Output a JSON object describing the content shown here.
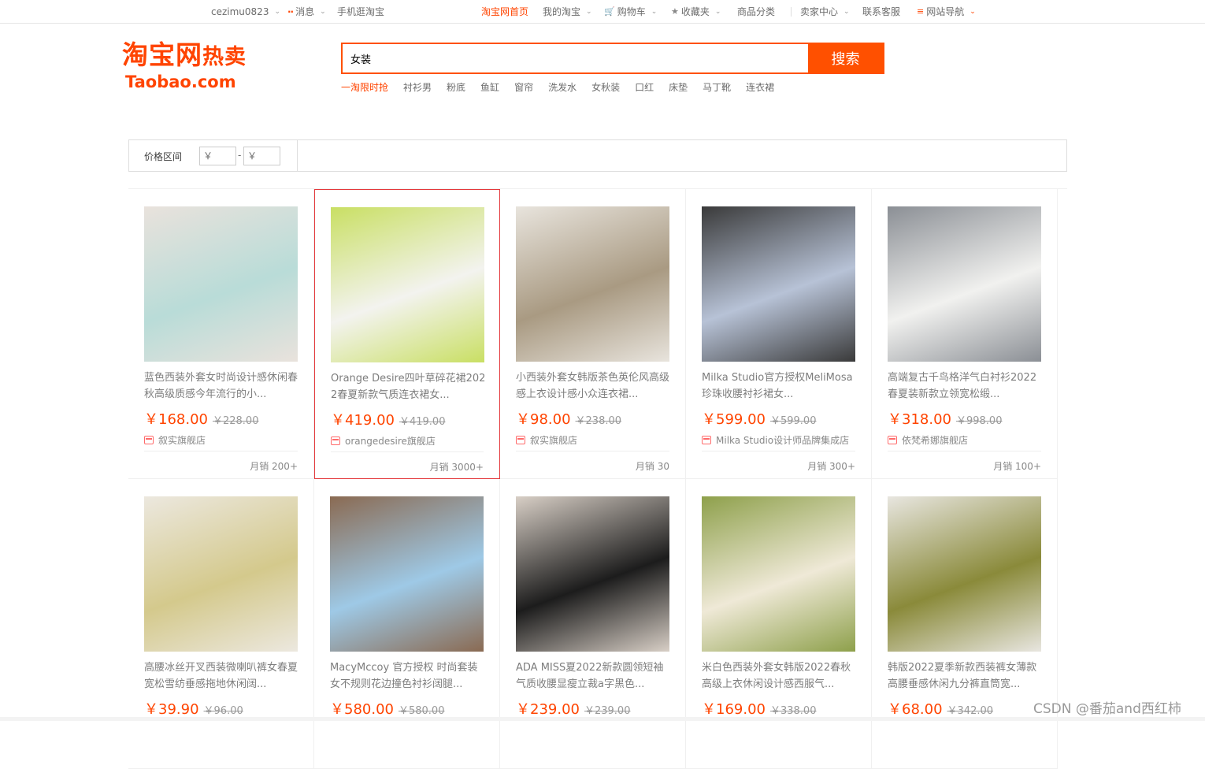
{
  "topbar": {
    "username": "cezimu0823",
    "messages": "消息",
    "mobile": "手机逛淘宝",
    "home": "淘宝网首页",
    "my_taobao": "我的淘宝",
    "cart": "购物车",
    "favorites": "收藏夹",
    "categories": "商品分类",
    "seller_center": "卖家中心",
    "contact": "联系客服",
    "site_nav": "网站导航",
    "accent": "#ff4400"
  },
  "logo": {
    "cn": "淘宝网",
    "cn_small": "热卖",
    "en": "Taobao.com"
  },
  "search": {
    "value": "女装",
    "button": "搜索"
  },
  "hotwords": [
    "一淘限时抢",
    "衬衫男",
    "粉底",
    "鱼缸",
    "窗帘",
    "洗发水",
    "女秋装",
    "口红",
    "床垫",
    "马丁靴",
    "连衣裙"
  ],
  "filter": {
    "label": "价格区间",
    "min_placeholder": "￥",
    "max_placeholder": "￥",
    "dash": "-"
  },
  "products": [
    {
      "title": "蓝色西装外套女时尚设计感休闲春秋高级质感今年流行的小...",
      "price": "￥168.00",
      "old": "￥228.00",
      "shop": "叙实旗舰店",
      "sales": "月销 200+",
      "colors": [
        "#b9dcd8",
        "#e9e2dc"
      ]
    },
    {
      "title": "Orange Desire四叶草碎花裙2022春夏新款气质连衣裙女...",
      "price": "￥419.00",
      "old": "￥419.00",
      "shop": "orangedesire旗舰店",
      "sales": "月销 3000+",
      "colors": [
        "#f3f3ef",
        "#c9df63"
      ]
    },
    {
      "title": "小西装外套女韩版茶色英伦风高级感上衣设计感小众连衣裙...",
      "price": "￥98.00",
      "old": "￥238.00",
      "shop": "叙实旗舰店",
      "sales": "月销 30",
      "colors": [
        "#a99a82",
        "#e8e4dd"
      ]
    },
    {
      "title": "Milka Studio官方授权MeliMosa珍珠收腰衬衫裙女...",
      "price": "￥599.00",
      "old": "￥599.00",
      "shop": "Milka Studio设计师品牌集成店",
      "sales": "月销 300+",
      "colors": [
        "#b7c2d6",
        "#3a3a3a"
      ]
    },
    {
      "title": "高端复古千鸟格洋气白衬衫2022春夏装新款立领宽松缎...",
      "price": "￥318.00",
      "old": "￥998.00",
      "shop": "依梵希娜旗舰店",
      "sales": "月销 100+",
      "colors": [
        "#f1f1ef",
        "#8b8f95"
      ]
    },
    {
      "title": "高腰冰丝开叉西装微喇叭裤女春夏宽松雪纺垂感拖地休闲阔...",
      "price": "￥39.90",
      "old": "￥96.00",
      "shop": "",
      "sales": "",
      "colors": [
        "#d4c98c",
        "#ece8df"
      ]
    },
    {
      "title": "MacyMccoy 官方授权 时尚套装女不规则花边撞色衬衫阔腿...",
      "price": "￥580.00",
      "old": "￥580.00",
      "shop": "",
      "sales": "",
      "colors": [
        "#9ec9e6",
        "#8a6a52"
      ]
    },
    {
      "title": "ADA MISS夏2022新款圆领短袖气质收腰显瘦立裁a字黑色...",
      "price": "￥239.00",
      "old": "￥239.00",
      "shop": "",
      "sales": "",
      "colors": [
        "#1c1c1c",
        "#d8cfc6"
      ]
    },
    {
      "title": "米白色西装外套女韩版2022春秋高级上衣休闲设计感西服气...",
      "price": "￥169.00",
      "old": "￥338.00",
      "shop": "",
      "sales": "",
      "colors": [
        "#efe9d7",
        "#8ea04b"
      ]
    },
    {
      "title": "韩版2022夏季新款西装裤女薄款高腰垂感休闲九分裤直筒宽...",
      "price": "￥68.00",
      "old": "￥342.00",
      "shop": "",
      "sales": "",
      "colors": [
        "#8a8a3a",
        "#e8e6e0"
      ]
    }
  ],
  "watermark": "CSDN @番茄and西红柿"
}
